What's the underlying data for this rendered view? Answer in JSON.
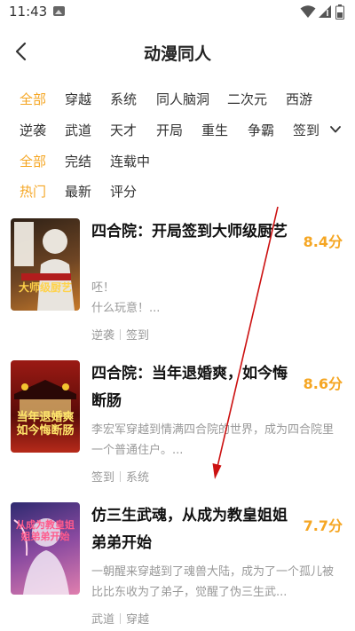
{
  "status_bar": {
    "time": "11:43",
    "icons": [
      "image-icon",
      "wifi-icon",
      "signal-icon",
      "battery-icon"
    ]
  },
  "header": {
    "title": "动漫同人",
    "back_icon": "back-arrow-icon"
  },
  "filters": {
    "genre_row1": [
      {
        "label": "全部",
        "active": true
      },
      {
        "label": "穿越",
        "active": false
      },
      {
        "label": "系统",
        "active": false
      },
      {
        "label": "同人脑洞",
        "active": false
      },
      {
        "label": "二次元",
        "active": false
      },
      {
        "label": "西游",
        "active": false
      }
    ],
    "genre_row2": [
      {
        "label": "逆袭",
        "active": false
      },
      {
        "label": "武道",
        "active": false
      },
      {
        "label": "天才",
        "active": false
      },
      {
        "label": "开局",
        "active": false
      },
      {
        "label": "重生",
        "active": false
      },
      {
        "label": "争霸",
        "active": false
      },
      {
        "label": "签到",
        "active": false
      }
    ],
    "status_row": [
      {
        "label": "全部",
        "active": true
      },
      {
        "label": "完结",
        "active": false
      },
      {
        "label": "连载中",
        "active": false
      }
    ],
    "sort_row": [
      {
        "label": "热门",
        "active": true
      },
      {
        "label": "最新",
        "active": false
      },
      {
        "label": "评分",
        "active": false
      }
    ],
    "expand_icon": "chevron-down-icon"
  },
  "books": [
    {
      "title": "四合院：开局签到大师级厨艺",
      "score": "8.4分",
      "intro": "呸！\n什么玩意！...",
      "tags": [
        "逆袭",
        "签到"
      ],
      "cover_text": "大师级厨艺",
      "cover_colors": [
        "#3b2a1c",
        "#7a4a22"
      ]
    },
    {
      "title": "四合院：当年退婚爽，如今悔断肠",
      "score": "8.6分",
      "intro": "李宏军穿越到情满四合院的世界，成为四合院里一个普通住户。...",
      "tags": [
        "签到",
        "系统"
      ],
      "cover_text": "当年退婚爽如今悔断肠",
      "cover_colors": [
        "#7a1010",
        "#b8261c"
      ]
    },
    {
      "title": "仿三生武魂，从成为教皇姐姐弟弟开始",
      "score": "7.7分",
      "intro": "一朝醒来穿越到了魂兽大陆，成为了一个孤儿被比比东收为了弟子，觉醒了伪三生武...",
      "tags": [
        "武道",
        "穿越"
      ],
      "cover_text": "从成为教皇姐姐弟弟开始",
      "cover_colors": [
        "#3a2a66",
        "#c0609a"
      ]
    }
  ],
  "colors": {
    "accent": "#f5a623",
    "annotation": "#cc1111"
  }
}
